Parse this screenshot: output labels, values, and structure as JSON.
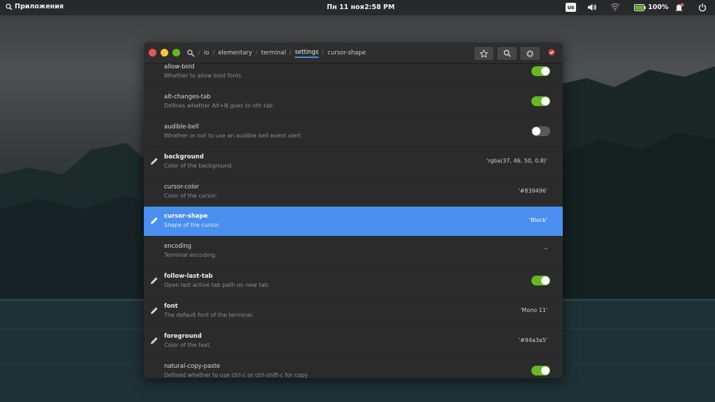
{
  "panel": {
    "applications_label": "Приложения",
    "date": "Пн 11 ноя",
    "time": "2:58 PM",
    "keyboard_layout": "us",
    "battery_percent": "100%"
  },
  "titlebar": {
    "breadcrumbs": [
      "io",
      "elementary",
      "terminal",
      "settings",
      "cursor-shape"
    ],
    "active_crumb": "settings"
  },
  "keys": [
    {
      "name": "allow-bold",
      "desc": "Whether to allow bold fonts.",
      "type": "toggle",
      "on": true,
      "modified": false
    },
    {
      "name": "alt-changes-tab",
      "desc": "Defines whether Alt+N goes to nth tab.",
      "type": "toggle",
      "on": true,
      "modified": false
    },
    {
      "name": "audible-bell",
      "desc": "Whether or not to use an audible bell event alert",
      "type": "toggle",
      "on": false,
      "modified": false
    },
    {
      "name": "background",
      "desc": "Color of the background.",
      "type": "value",
      "value": "'rgba(37, 46, 50, 0.8)'",
      "modified": true
    },
    {
      "name": "cursor-color",
      "desc": "Color of the cursor.",
      "type": "value",
      "value": "'#839496'",
      "modified": false
    },
    {
      "name": "cursor-shape",
      "desc": "Shape of the cursor.",
      "type": "value",
      "value": "'Block'",
      "modified": true,
      "selected": true
    },
    {
      "name": "encoding",
      "desc": "Terminal encoding.",
      "type": "value",
      "value": "''",
      "modified": false
    },
    {
      "name": "follow-last-tab",
      "desc": "Open last active tab path on new tab.",
      "type": "toggle",
      "on": true,
      "modified": true
    },
    {
      "name": "font",
      "desc": "The default font of the terminal.",
      "type": "value",
      "value": "'Mono 11'",
      "modified": true
    },
    {
      "name": "foreground",
      "desc": "Color of the text.",
      "type": "value",
      "value": "'#94a3a5'",
      "modified": true
    },
    {
      "name": "natural-copy-paste",
      "desc": "Defined whether to use ctrl-c or ctrl-shift-c for copy",
      "type": "toggle",
      "on": true,
      "modified": false
    }
  ],
  "colors": {
    "accent": "#4a8ff0",
    "toggle_on": "#68b723",
    "close": "#ed5353",
    "minimize": "#f9c440",
    "maximize": "#68b723"
  },
  "icons": {
    "panel": [
      "search-icon",
      "volume-icon",
      "wifi-icon",
      "battery-icon",
      "notification-icon",
      "power-icon"
    ],
    "titlebar": [
      "star-icon",
      "search-icon",
      "gear-icon",
      "app-icon"
    ],
    "row": "pencil-icon"
  }
}
